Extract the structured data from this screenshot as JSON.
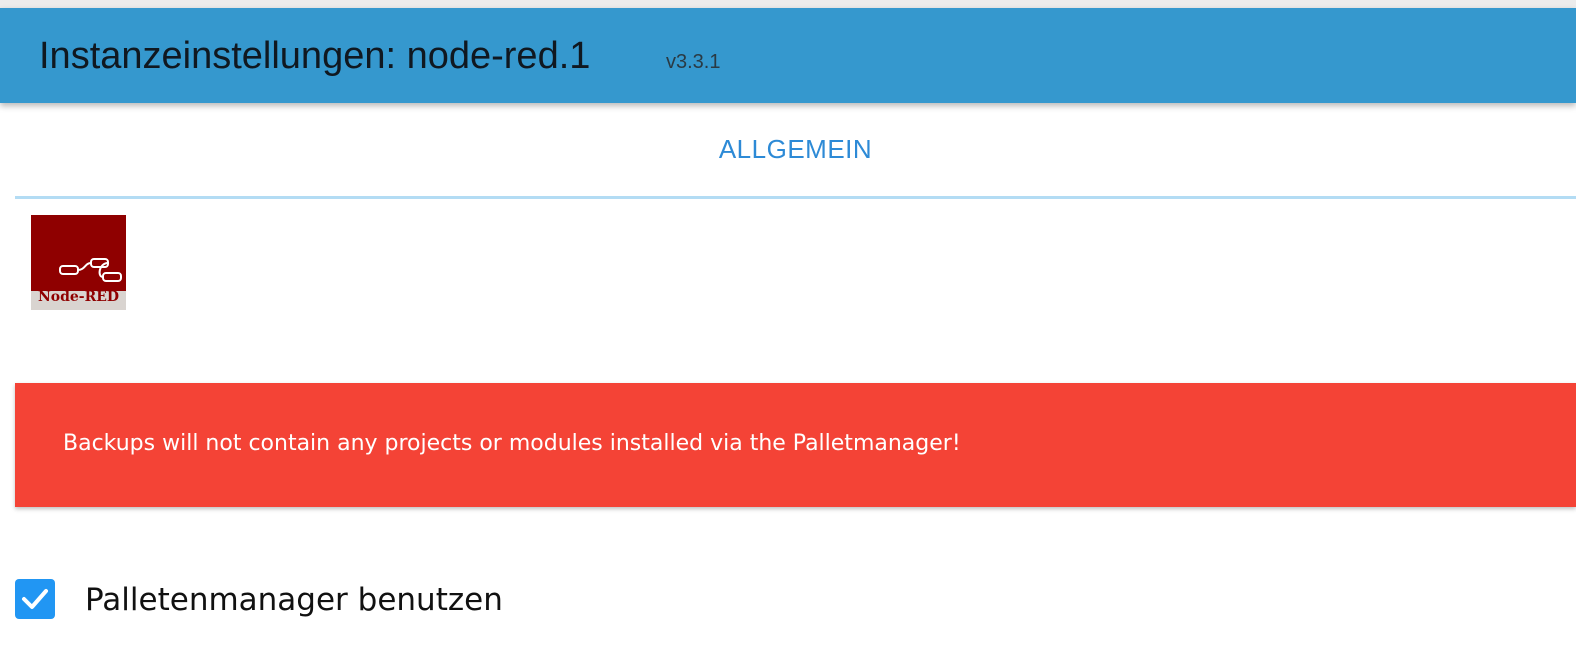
{
  "header": {
    "title": "Instanzeinstellungen: node-red.1",
    "version": "v3.3.1",
    "background_color": "#3598ce"
  },
  "tabs": [
    {
      "label": "ALLGEMEIN",
      "active": true
    }
  ],
  "logo": {
    "label": "Node-RED",
    "icon": "node-red-flow-icon",
    "background_color": "#8f0000"
  },
  "alert": {
    "message": "Backups will not contain any projects or modules installed via the Palletmanager!",
    "background_color": "#f44336"
  },
  "settings": {
    "use_palette_manager": {
      "label": "Palletenmanager benutzen",
      "checked": true,
      "icon": "checkmark-icon"
    }
  }
}
